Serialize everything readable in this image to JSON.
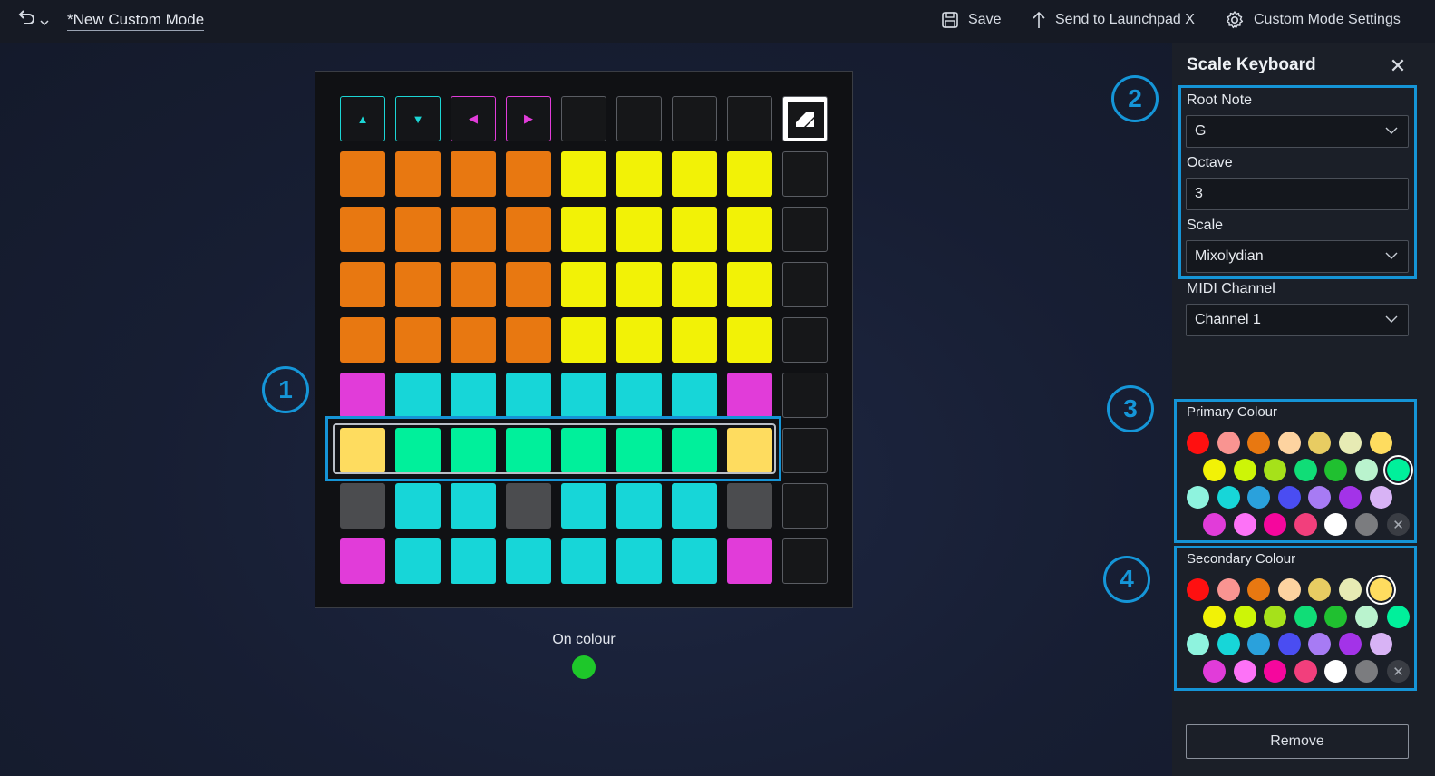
{
  "topbar": {
    "title": "*New Custom Mode",
    "save_label": "Save",
    "send_label": "Send to Launchpad X",
    "settings_label": "Custom Mode Settings"
  },
  "colors": {
    "orange": "#e87811",
    "yellow": "#f2f206",
    "cyan": "#17d6d8",
    "magenta": "#e13cd9",
    "light_yellow": "#fedc5f",
    "green": "#00f09b",
    "gray": "#4b4c4f",
    "on_colour": "#1ec72a"
  },
  "grid": {
    "top_row": [
      {
        "glyph": "▲",
        "color": "#1cd5d4"
      },
      {
        "glyph": "▼",
        "color": "#1cd5d4"
      },
      {
        "glyph": "◀",
        "color": "#e13cd9"
      },
      {
        "glyph": "▶",
        "color": "#e13cd9"
      }
    ],
    "rows": [
      [
        "orange",
        "orange",
        "orange",
        "orange",
        "yellow",
        "yellow",
        "yellow",
        "yellow"
      ],
      [
        "orange",
        "orange",
        "orange",
        "orange",
        "yellow",
        "yellow",
        "yellow",
        "yellow"
      ],
      [
        "orange",
        "orange",
        "orange",
        "orange",
        "yellow",
        "yellow",
        "yellow",
        "yellow"
      ],
      [
        "orange",
        "orange",
        "orange",
        "orange",
        "yellow",
        "yellow",
        "yellow",
        "yellow"
      ],
      [
        "magenta",
        "cyan",
        "cyan",
        "cyan",
        "cyan",
        "cyan",
        "cyan",
        "magenta"
      ],
      [
        "light_yellow",
        "green",
        "green",
        "green",
        "green",
        "green",
        "green",
        "light_yellow"
      ],
      [
        "gray",
        "cyan",
        "cyan",
        "gray",
        "cyan",
        "cyan",
        "cyan",
        "gray"
      ],
      [
        "magenta",
        "cyan",
        "cyan",
        "cyan",
        "cyan",
        "cyan",
        "cyan",
        "magenta"
      ]
    ]
  },
  "badges": [
    "1",
    "2",
    "3",
    "4"
  ],
  "on_colour_label": "On colour",
  "panel": {
    "title": "Scale Keyboard",
    "root_note_label": "Root Note",
    "root_note_value": "G",
    "octave_label": "Octave",
    "octave_value": "3",
    "scale_label": "Scale",
    "scale_value": "Mixolydian",
    "midi_label": "MIDI Channel",
    "midi_value": "Channel 1",
    "primary_label": "Primary Colour",
    "secondary_label": "Secondary Colour",
    "remove_label": "Remove"
  },
  "palette": [
    [
      "#ff1010",
      "#f99491",
      "#e87811",
      "#fdd3a0",
      "#e8cc62",
      "#e7ebb4",
      "#fedc5f"
    ],
    [
      "#f2f206",
      "#cdf507",
      "#a6e11a",
      "#10dd77",
      "#20c030",
      "#baf3ce",
      "#00f09b"
    ],
    [
      "#8ef3de",
      "#17d6d8",
      "#2aa1dc",
      "#4a4df2",
      "#a77bf4",
      "#a333e8",
      "#d8b3f5"
    ],
    [
      "#e13cd9",
      "#fd72f7",
      "#f5079d",
      "#f23f7c",
      "#ffffff",
      "#7b7c7f",
      "x"
    ]
  ],
  "primary_selected": "#00f09b",
  "secondary_selected": "#fedc5f"
}
